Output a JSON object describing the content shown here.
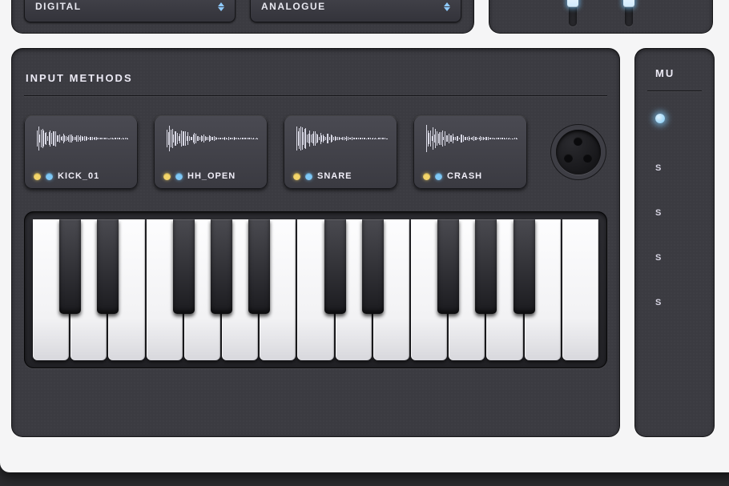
{
  "dropdowns": {
    "left": "DIGITAL",
    "right": "ANALOGUE"
  },
  "section_title": "INPUT METHODS",
  "side_title": "MU",
  "side_labels": [
    "S",
    "S",
    "S",
    "S"
  ],
  "pads": [
    {
      "label": "KICK_01"
    },
    {
      "label": "HH_OPEN"
    },
    {
      "label": "SNARE"
    },
    {
      "label": "CRASH"
    }
  ],
  "keyboard": {
    "white_keys": 15
  }
}
